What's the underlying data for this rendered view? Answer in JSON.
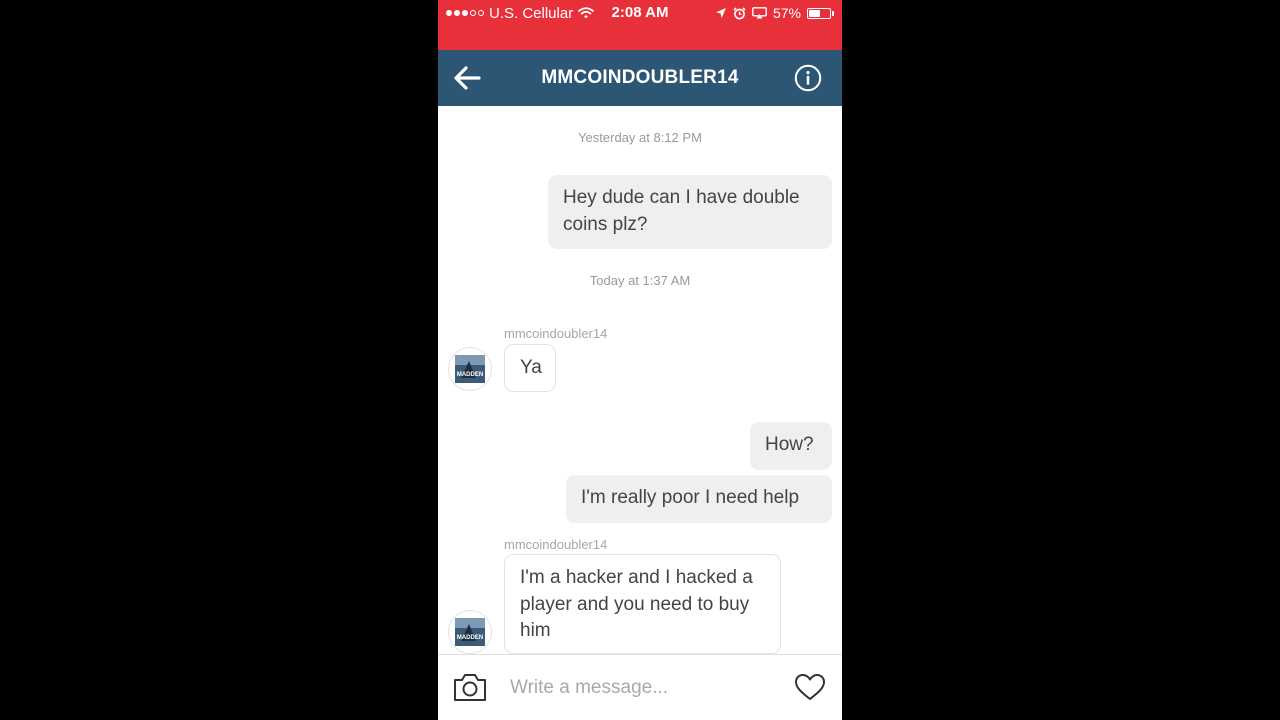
{
  "status_bar": {
    "carrier": "U.S. Cellular",
    "time": "2:08 AM",
    "battery_percent": "57%",
    "battery_level": 0.57,
    "signal_bars_filled": 3,
    "signal_bars_total": 5,
    "icons": [
      "wifi-icon",
      "location-arrow-icon",
      "alarm-icon",
      "airplay-icon",
      "battery-icon"
    ]
  },
  "header": {
    "title": "MMCOINDOUBLER14",
    "back_icon": "arrow-left-icon",
    "info_icon": "info-circle-icon"
  },
  "thread": {
    "timestamp_1": "Yesterday at 8:12 PM",
    "msg_1": "Hey dude can I have double coins plz?",
    "timestamp_2": "Today at 1:37 AM",
    "sender_1": "mmcoindoubler14",
    "msg_2": "Ya",
    "msg_3": "How?",
    "msg_4": "I'm really poor I need help",
    "sender_2": "mmcoindoubler14",
    "msg_5": "I'm a hacker and I hacked a player and you need to buy him",
    "avatar_text": "MADDEN"
  },
  "composer": {
    "placeholder": "Write a message...",
    "camera_icon": "camera-icon",
    "heart_icon": "heart-icon"
  },
  "colors": {
    "status_bar": "#e8303a",
    "header": "#2c5674",
    "outgoing_bubble": "#efefef",
    "incoming_border": "#e3e3e3"
  }
}
